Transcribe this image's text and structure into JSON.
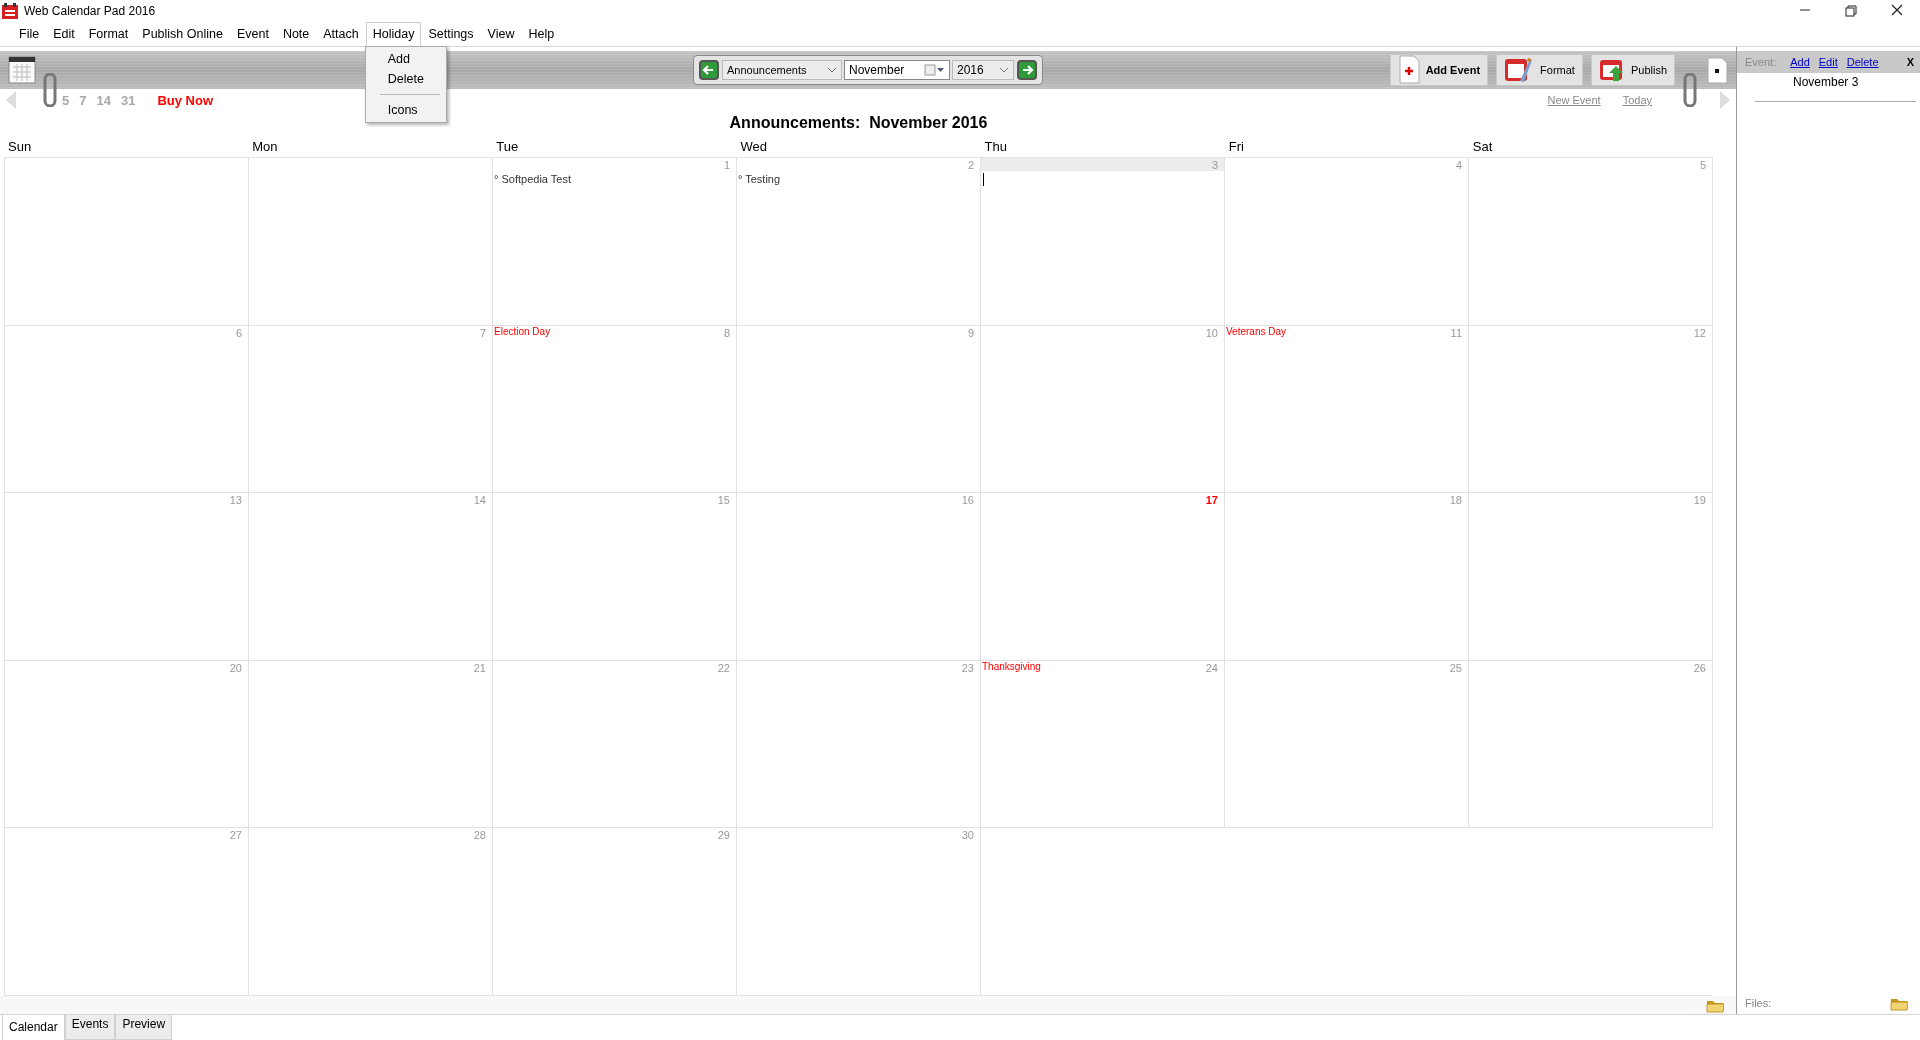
{
  "window": {
    "title": "Web Calendar Pad 2016"
  },
  "menu": [
    {
      "label": "File",
      "open": false
    },
    {
      "label": "Edit",
      "open": false
    },
    {
      "label": "Format",
      "open": false
    },
    {
      "label": "Publish Online",
      "open": false
    },
    {
      "label": "Event",
      "open": false
    },
    {
      "label": "Note",
      "open": false
    },
    {
      "label": "Attach",
      "open": false
    },
    {
      "label": "Holiday",
      "open": true
    },
    {
      "label": "Settings",
      "open": false
    },
    {
      "label": "View",
      "open": false
    },
    {
      "label": "Help",
      "open": false
    }
  ],
  "holiday_menu": [
    {
      "kind": "item",
      "label": "Add"
    },
    {
      "kind": "item",
      "label": "Delete"
    },
    {
      "kind": "separator"
    },
    {
      "kind": "item",
      "label": "Icons"
    }
  ],
  "toolbar": {
    "calendar_select": "Announcements",
    "month": "November",
    "year": "2016",
    "buttons": [
      {
        "kind": "add",
        "label": "Add Event"
      },
      {
        "kind": "format",
        "label": "Format"
      },
      {
        "kind": "publish",
        "label": "Publish"
      }
    ]
  },
  "quick_range": [
    "5",
    "7",
    "14",
    "31"
  ],
  "buy_now": "Buy Now",
  "links": [
    "New Event",
    "Today"
  ],
  "calendar": {
    "title": "Announcements:  November 2016",
    "weekdays": [
      "Sun",
      "Mon",
      "Tue",
      "Wed",
      "Thu",
      "Fri",
      "Sat"
    ],
    "weeks": [
      [
        {
          "day": "1",
          "selected": false,
          "today": false,
          "events": [
            "° Softpedia Test"
          ]
        },
        {
          "day": "2",
          "selected": false,
          "today": false,
          "events": [
            "° Testing"
          ]
        },
        {
          "day": "3",
          "selected": true,
          "today": false
        },
        {
          "day": "4",
          "selected": false,
          "today": false
        },
        {
          "day": "5",
          "selected": false,
          "today": false
        }
      ],
      [
        {
          "day": "6",
          "selected": false,
          "today": false
        },
        {
          "day": "7",
          "selected": false,
          "today": false
        },
        {
          "day": "8",
          "selected": false,
          "today": false,
          "holiday": "Election Day"
        },
        {
          "day": "9",
          "selected": false,
          "today": false
        },
        {
          "day": "10",
          "selected": false,
          "today": false
        },
        {
          "day": "11",
          "selected": false,
          "today": false,
          "holiday": "Veterans Day"
        },
        {
          "day": "12",
          "selected": false,
          "today": false
        }
      ],
      [
        {
          "day": "13",
          "selected": false,
          "today": false
        },
        {
          "day": "14",
          "selected": false,
          "today": false
        },
        {
          "day": "15",
          "selected": false,
          "today": false
        },
        {
          "day": "16",
          "selected": false,
          "today": false
        },
        {
          "day": "17",
          "selected": false,
          "today": true
        },
        {
          "day": "18",
          "selected": false,
          "today": false
        },
        {
          "day": "19",
          "selected": false,
          "today": false
        }
      ],
      [
        {
          "day": "20",
          "selected": false,
          "today": false
        },
        {
          "day": "21",
          "selected": false,
          "today": false
        },
        {
          "day": "22",
          "selected": false,
          "today": false
        },
        {
          "day": "23",
          "selected": false,
          "today": false
        },
        {
          "day": "24",
          "selected": false,
          "today": false,
          "holiday": "Thanksgiving"
        },
        {
          "day": "25",
          "selected": false,
          "today": false
        },
        {
          "day": "26",
          "selected": false,
          "today": false
        }
      ],
      [
        {
          "day": "27",
          "selected": false,
          "today": false
        },
        {
          "day": "28",
          "selected": false,
          "today": false
        },
        {
          "day": "29",
          "selected": false,
          "today": false
        },
        {
          "day": "30",
          "selected": false,
          "today": false
        }
      ]
    ]
  },
  "side_panel": {
    "event_label": "Event:",
    "actions": [
      "Add",
      "Edit",
      "Delete"
    ],
    "close": "X",
    "date": "November 3",
    "files_label": "Files:"
  },
  "tabs": [
    {
      "label": "Calendar",
      "selected": true
    },
    {
      "label": "Events",
      "selected": false
    },
    {
      "label": "Preview",
      "selected": false
    }
  ]
}
